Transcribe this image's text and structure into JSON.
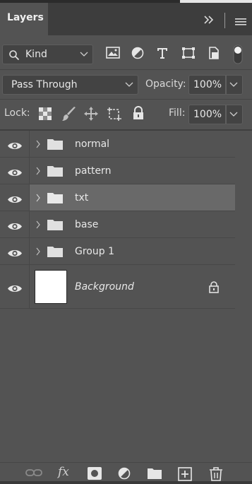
{
  "panel": {
    "tab_label": "Layers",
    "collapse_icon": "double-chevron-right-icon",
    "menu_icon": "hamburger-menu-icon"
  },
  "filter": {
    "kind_label": "Kind",
    "icons": [
      "image-filter-icon",
      "adjustment-filter-icon",
      "type-filter-icon",
      "shape-filter-icon",
      "smart-object-filter-icon",
      "filter-toggle-icon"
    ]
  },
  "blend": {
    "mode": "Pass Through",
    "opacity_label": "Opacity:",
    "opacity_value": "100%"
  },
  "lock": {
    "label": "Lock:",
    "icons": [
      "lock-transparent-icon",
      "lock-image-icon",
      "lock-position-icon",
      "lock-artboard-icon",
      "lock-all-icon"
    ],
    "fill_label": "Fill:",
    "fill_value": "100%"
  },
  "layers": [
    {
      "name": "normal",
      "type": "group",
      "selected": false
    },
    {
      "name": "pattern",
      "type": "group",
      "selected": false
    },
    {
      "name": "txt",
      "type": "group",
      "selected": true
    },
    {
      "name": "base",
      "type": "group",
      "selected": false
    },
    {
      "name": "Group 1",
      "type": "group",
      "selected": false
    }
  ],
  "background_layer": {
    "name": "Background",
    "locked": true
  },
  "bottom_bar": {
    "icons": [
      "link-layers-icon",
      "fx-icon",
      "add-mask-icon",
      "new-adjustment-icon",
      "new-group-icon",
      "new-layer-icon",
      "delete-icon"
    ],
    "fx_label": "fx"
  },
  "colors": {
    "panel_bg": "#535353",
    "selected_row": "#696969",
    "titlebar_bg": "#3d3d3d"
  }
}
